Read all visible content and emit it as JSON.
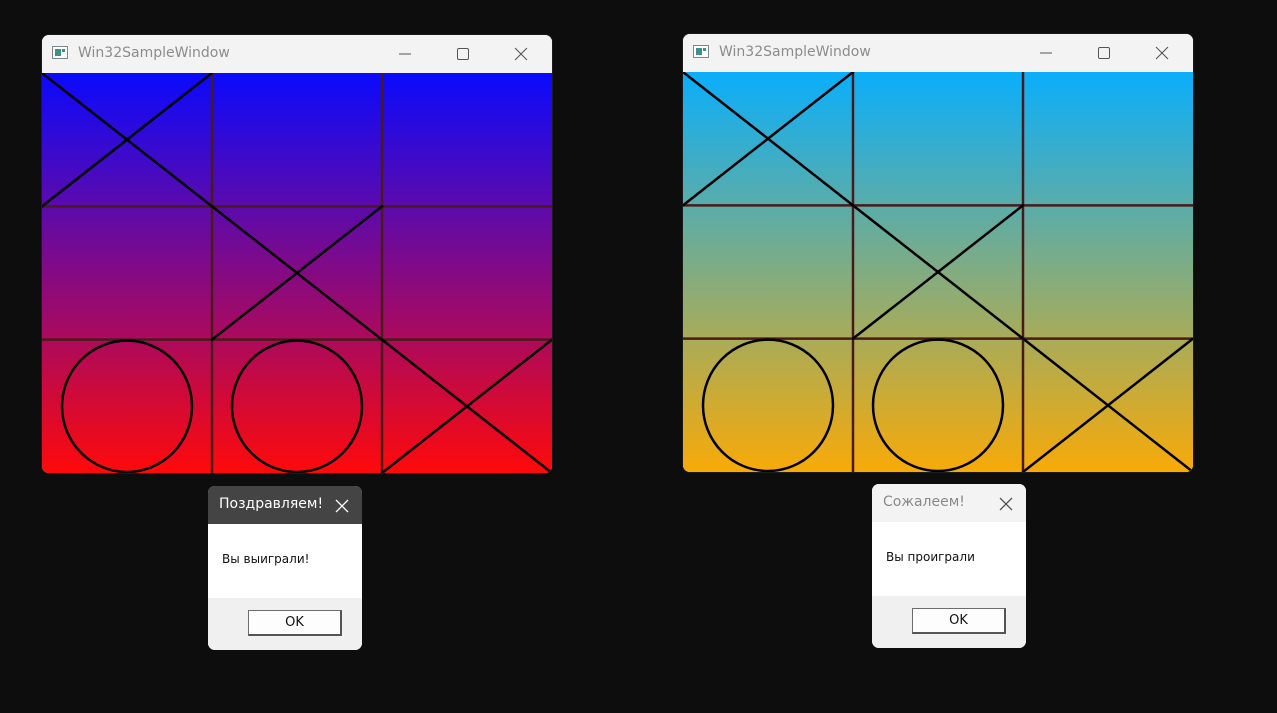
{
  "windows": [
    {
      "title": "Win32SampleWindow",
      "gradient_top": "#0a0afd",
      "gradient_bottom": "#fe0a0a",
      "board": [
        [
          "X",
          "",
          ""
        ],
        [
          "",
          "X",
          ""
        ],
        [
          "O",
          "O",
          "X"
        ]
      ]
    },
    {
      "title": "Win32SampleWindow",
      "gradient_top": "#0aaefb",
      "gradient_bottom": "#f8aa08",
      "board": [
        [
          "X",
          "",
          ""
        ],
        [
          "",
          "X",
          ""
        ],
        [
          "O",
          "O",
          "X"
        ]
      ]
    }
  ],
  "dialogs": [
    {
      "title": "Поздравляем!",
      "message": "Вы выиграли!",
      "ok_label": "OK",
      "titlebar_bg": "#444444",
      "title_color": "#ffffff",
      "close_color": "#ffffff"
    },
    {
      "title": "Сожалеем!",
      "message": "Вы проиграли",
      "ok_label": "OK",
      "titlebar_bg": "#f3f3f3",
      "title_color": "#8a8a8a",
      "close_color": "#555555"
    }
  ],
  "colors": {
    "grid_line": "#4a1a1a",
    "mark_stroke": "#000000",
    "desktop_bg": "#0d0d0d"
  },
  "icons": [
    "app-window-icon",
    "minimize-icon",
    "maximize-icon",
    "close-icon"
  ]
}
